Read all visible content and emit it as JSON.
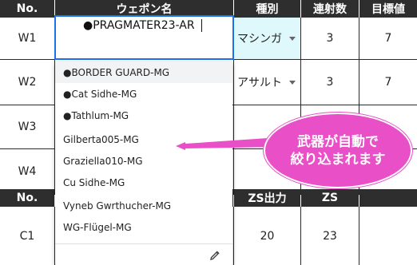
{
  "header1": {
    "no": "No.",
    "weapon_name": "ウェポン名",
    "type": "種別",
    "rapid": "連射数",
    "target": "目標値"
  },
  "rows": [
    {
      "no": "W1",
      "type": "マシンガ",
      "rapid": "3",
      "target": "7"
    },
    {
      "no": "W2",
      "type": "アサルト",
      "rapid": "3",
      "target": "7"
    },
    {
      "no": "W3"
    },
    {
      "no": "W4"
    }
  ],
  "header2": {
    "no": "No.",
    "zs_output": "ZS出力",
    "zs": "ZS"
  },
  "c_rows": [
    {
      "no": "C1",
      "zs_output": "20",
      "zs": "23"
    }
  ],
  "editor": {
    "value": "●PRAGMATER23-AR"
  },
  "dropdown": {
    "items": [
      "●BORDER GUARD-MG",
      "●Cat Sidhe-MG",
      "●Tathlum-MG",
      "Gilberta005-MG",
      "Graziella010-MG",
      "Cu Sidhe-MG",
      "Vyneb Gwrthucher-MG",
      "WG-Flügel-MG"
    ],
    "edit_icon": "pencil-icon"
  },
  "callout": {
    "line1": "武器が自動で",
    "line2": "絞り込まれます",
    "color": "#e94fc6"
  },
  "colors": {
    "header_bg": "#2e2e2e",
    "selected_cell": "#dff8fb",
    "editor_border": "#1a73e8"
  }
}
